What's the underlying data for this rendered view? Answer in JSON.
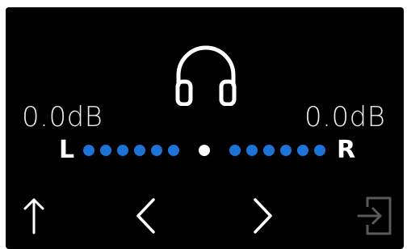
{
  "balance": {
    "left_level": "0.0dB",
    "right_level": "0.0dB",
    "left_channel": "L",
    "right_channel": "R",
    "steps_per_side": 6,
    "position": 0
  },
  "colors": {
    "background": "#000000",
    "dot_active": "#1e73d8",
    "dot_center": "#ffffff",
    "text": "#ebebeb",
    "disabled_icon": "#5a5a5a"
  },
  "icons": {
    "output": "headphones-icon",
    "up": "up-arrow-icon",
    "prev": "chevron-left-icon",
    "next": "chevron-right-icon",
    "exit": "exit-icon"
  }
}
